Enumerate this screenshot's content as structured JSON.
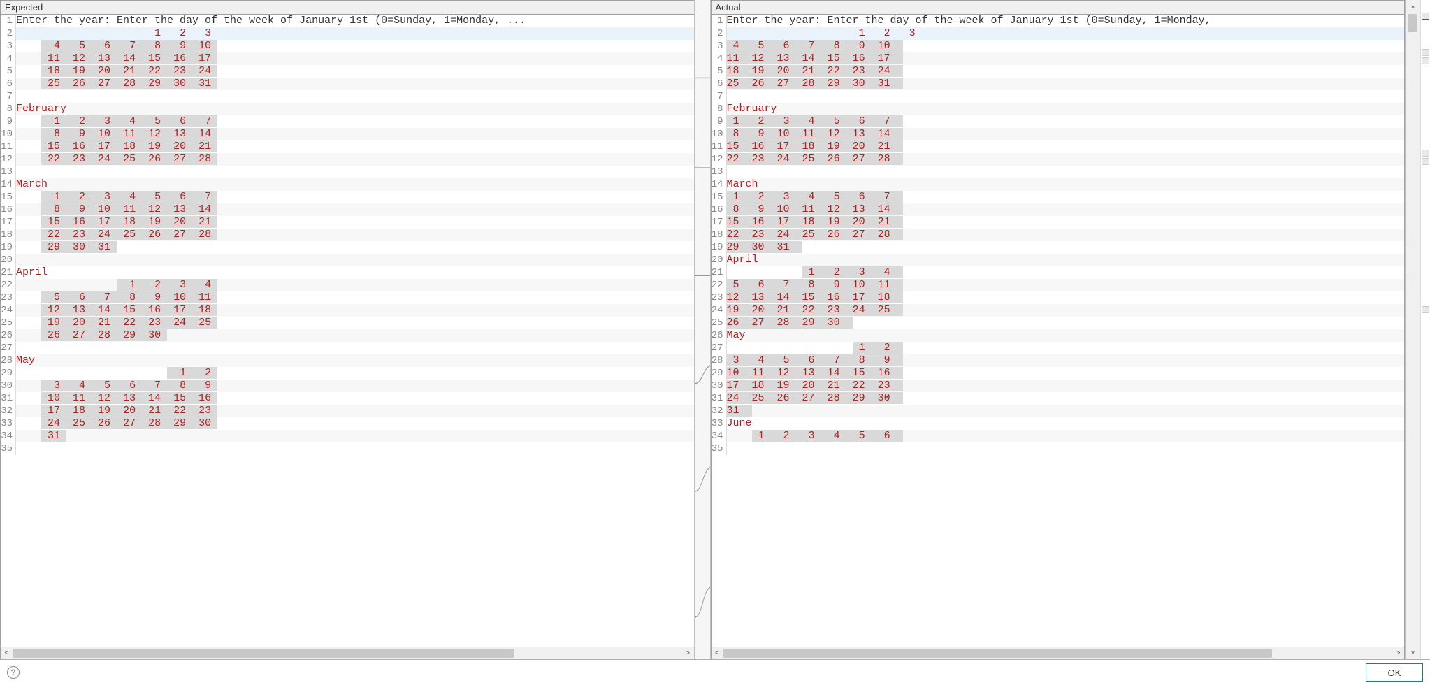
{
  "panes": {
    "left": {
      "title": "Expected"
    },
    "right": {
      "title": "Actual"
    }
  },
  "footer": {
    "ok": "OK"
  },
  "help_tooltip": "?",
  "left_lines": [
    {
      "n": 1,
      "type": "plain",
      "text": "Enter the year: Enter the day of the week of January 1st (0=Sunday, 1=Monday, ..."
    },
    {
      "n": 2,
      "type": "highlight",
      "cells": [
        "",
        "",
        "",
        "",
        "",
        "1",
        "2",
        "3"
      ]
    },
    {
      "n": 3,
      "type": "diff",
      "cells": [
        "",
        "4",
        "5",
        "6",
        "7",
        "8",
        "9",
        "10"
      ]
    },
    {
      "n": 4,
      "type": "diff",
      "cells": [
        "",
        "11",
        "12",
        "13",
        "14",
        "15",
        "16",
        "17"
      ]
    },
    {
      "n": 5,
      "type": "diff",
      "cells": [
        "",
        "18",
        "19",
        "20",
        "21",
        "22",
        "23",
        "24"
      ]
    },
    {
      "n": 6,
      "type": "diff",
      "cells": [
        "",
        "25",
        "26",
        "27",
        "28",
        "29",
        "30",
        "31"
      ]
    },
    {
      "n": 7,
      "type": "blank"
    },
    {
      "n": 8,
      "type": "month",
      "text": "February"
    },
    {
      "n": 9,
      "type": "diff",
      "cells": [
        "",
        "1",
        "2",
        "3",
        "4",
        "5",
        "6",
        "7"
      ]
    },
    {
      "n": 10,
      "type": "diff",
      "cells": [
        "",
        "8",
        "9",
        "10",
        "11",
        "12",
        "13",
        "14"
      ]
    },
    {
      "n": 11,
      "type": "diff",
      "cells": [
        "",
        "15",
        "16",
        "17",
        "18",
        "19",
        "20",
        "21"
      ]
    },
    {
      "n": 12,
      "type": "diff",
      "cells": [
        "",
        "22",
        "23",
        "24",
        "25",
        "26",
        "27",
        "28"
      ]
    },
    {
      "n": 13,
      "type": "blank"
    },
    {
      "n": 14,
      "type": "month",
      "text": "March"
    },
    {
      "n": 15,
      "type": "diff",
      "cells": [
        "",
        "1",
        "2",
        "3",
        "4",
        "5",
        "6",
        "7"
      ]
    },
    {
      "n": 16,
      "type": "diff",
      "cells": [
        "",
        "8",
        "9",
        "10",
        "11",
        "12",
        "13",
        "14"
      ]
    },
    {
      "n": 17,
      "type": "diff",
      "cells": [
        "",
        "15",
        "16",
        "17",
        "18",
        "19",
        "20",
        "21"
      ]
    },
    {
      "n": 18,
      "type": "diff",
      "cells": [
        "",
        "22",
        "23",
        "24",
        "25",
        "26",
        "27",
        "28"
      ]
    },
    {
      "n": 19,
      "type": "diff",
      "cells": [
        "",
        "29",
        "30",
        "31"
      ]
    },
    {
      "n": 20,
      "type": "blank"
    },
    {
      "n": 21,
      "type": "month",
      "text": "April"
    },
    {
      "n": 22,
      "type": "diff",
      "cells": [
        "",
        "",
        "",
        "",
        "1",
        "2",
        "3",
        "4"
      ]
    },
    {
      "n": 23,
      "type": "diff",
      "cells": [
        "",
        "5",
        "6",
        "7",
        "8",
        "9",
        "10",
        "11"
      ]
    },
    {
      "n": 24,
      "type": "diff",
      "cells": [
        "",
        "12",
        "13",
        "14",
        "15",
        "16",
        "17",
        "18"
      ]
    },
    {
      "n": 25,
      "type": "diff",
      "cells": [
        "",
        "19",
        "20",
        "21",
        "22",
        "23",
        "24",
        "25"
      ]
    },
    {
      "n": 26,
      "type": "diff",
      "cells": [
        "",
        "26",
        "27",
        "28",
        "29",
        "30"
      ]
    },
    {
      "n": 27,
      "type": "blank"
    },
    {
      "n": 28,
      "type": "month",
      "text": "May"
    },
    {
      "n": 29,
      "type": "diff",
      "cells": [
        "",
        "",
        "",
        "",
        "",
        "",
        "1",
        "2"
      ]
    },
    {
      "n": 30,
      "type": "diff",
      "cells": [
        "",
        "3",
        "4",
        "5",
        "6",
        "7",
        "8",
        "9"
      ]
    },
    {
      "n": 31,
      "type": "diff",
      "cells": [
        "",
        "10",
        "11",
        "12",
        "13",
        "14",
        "15",
        "16"
      ]
    },
    {
      "n": 32,
      "type": "diff",
      "cells": [
        "",
        "17",
        "18",
        "19",
        "20",
        "21",
        "22",
        "23"
      ]
    },
    {
      "n": 33,
      "type": "diff",
      "cells": [
        "",
        "24",
        "25",
        "26",
        "27",
        "28",
        "29",
        "30"
      ]
    },
    {
      "n": 34,
      "type": "diff",
      "cells": [
        "",
        "31"
      ]
    },
    {
      "n": 35,
      "type": "blank"
    }
  ],
  "right_lines": [
    {
      "n": 1,
      "type": "plain",
      "text": "Enter the year: Enter the day of the week of January 1st (0=Sunday, 1=Monday,"
    },
    {
      "n": 2,
      "type": "highlight",
      "cells": [
        "",
        "",
        "",
        "",
        "",
        "1",
        "2",
        "3"
      ]
    },
    {
      "n": 3,
      "type": "diff",
      "cells": [
        "4",
        "5",
        "6",
        "7",
        "8",
        "9",
        "10"
      ]
    },
    {
      "n": 4,
      "type": "diff",
      "cells": [
        "11",
        "12",
        "13",
        "14",
        "15",
        "16",
        "17"
      ]
    },
    {
      "n": 5,
      "type": "diff",
      "cells": [
        "18",
        "19",
        "20",
        "21",
        "22",
        "23",
        "24"
      ]
    },
    {
      "n": 6,
      "type": "diff",
      "cells": [
        "25",
        "26",
        "27",
        "28",
        "29",
        "30",
        "31"
      ]
    },
    {
      "n": 7,
      "type": "blank"
    },
    {
      "n": 8,
      "type": "month",
      "text": "February"
    },
    {
      "n": 9,
      "type": "diff",
      "cells": [
        "1",
        "2",
        "3",
        "4",
        "5",
        "6",
        "7"
      ]
    },
    {
      "n": 10,
      "type": "diff",
      "cells": [
        "8",
        "9",
        "10",
        "11",
        "12",
        "13",
        "14"
      ]
    },
    {
      "n": 11,
      "type": "diff",
      "cells": [
        "15",
        "16",
        "17",
        "18",
        "19",
        "20",
        "21"
      ]
    },
    {
      "n": 12,
      "type": "diff",
      "cells": [
        "22",
        "23",
        "24",
        "25",
        "26",
        "27",
        "28"
      ]
    },
    {
      "n": 13,
      "type": "blank"
    },
    {
      "n": 14,
      "type": "month",
      "text": "March"
    },
    {
      "n": 15,
      "type": "diff",
      "cells": [
        "1",
        "2",
        "3",
        "4",
        "5",
        "6",
        "7"
      ]
    },
    {
      "n": 16,
      "type": "diff",
      "cells": [
        "8",
        "9",
        "10",
        "11",
        "12",
        "13",
        "14"
      ]
    },
    {
      "n": 17,
      "type": "diff",
      "cells": [
        "15",
        "16",
        "17",
        "18",
        "19",
        "20",
        "21"
      ]
    },
    {
      "n": 18,
      "type": "diff",
      "cells": [
        "22",
        "23",
        "24",
        "25",
        "26",
        "27",
        "28"
      ]
    },
    {
      "n": 19,
      "type": "diff",
      "cells": [
        "29",
        "30",
        "31"
      ]
    },
    {
      "n": 20,
      "type": "month",
      "text": "April"
    },
    {
      "n": 21,
      "type": "diff",
      "cells": [
        "",
        "",
        "",
        "1",
        "2",
        "3",
        "4"
      ]
    },
    {
      "n": 22,
      "type": "diff",
      "cells": [
        "5",
        "6",
        "7",
        "8",
        "9",
        "10",
        "11"
      ]
    },
    {
      "n": 23,
      "type": "diff",
      "cells": [
        "12",
        "13",
        "14",
        "15",
        "16",
        "17",
        "18"
      ]
    },
    {
      "n": 24,
      "type": "diff",
      "cells": [
        "19",
        "20",
        "21",
        "22",
        "23",
        "24",
        "25"
      ]
    },
    {
      "n": 25,
      "type": "diff",
      "cells": [
        "26",
        "27",
        "28",
        "29",
        "30"
      ]
    },
    {
      "n": 26,
      "type": "month",
      "text": "May"
    },
    {
      "n": 27,
      "type": "diff",
      "cells": [
        "",
        "",
        "",
        "",
        "",
        "1",
        "2"
      ]
    },
    {
      "n": 28,
      "type": "diff",
      "cells": [
        "3",
        "4",
        "5",
        "6",
        "7",
        "8",
        "9"
      ]
    },
    {
      "n": 29,
      "type": "diff",
      "cells": [
        "10",
        "11",
        "12",
        "13",
        "14",
        "15",
        "16"
      ]
    },
    {
      "n": 30,
      "type": "diff",
      "cells": [
        "17",
        "18",
        "19",
        "20",
        "21",
        "22",
        "23"
      ]
    },
    {
      "n": 31,
      "type": "diff",
      "cells": [
        "24",
        "25",
        "26",
        "27",
        "28",
        "29",
        "30"
      ]
    },
    {
      "n": 32,
      "type": "diff",
      "cells": [
        "31"
      ]
    },
    {
      "n": 33,
      "type": "month",
      "text": "June"
    },
    {
      "n": 34,
      "type": "diff",
      "cells": [
        "",
        "1",
        "2",
        "3",
        "4",
        "5",
        "6"
      ]
    },
    {
      "n": 35,
      "type": "blank"
    }
  ]
}
